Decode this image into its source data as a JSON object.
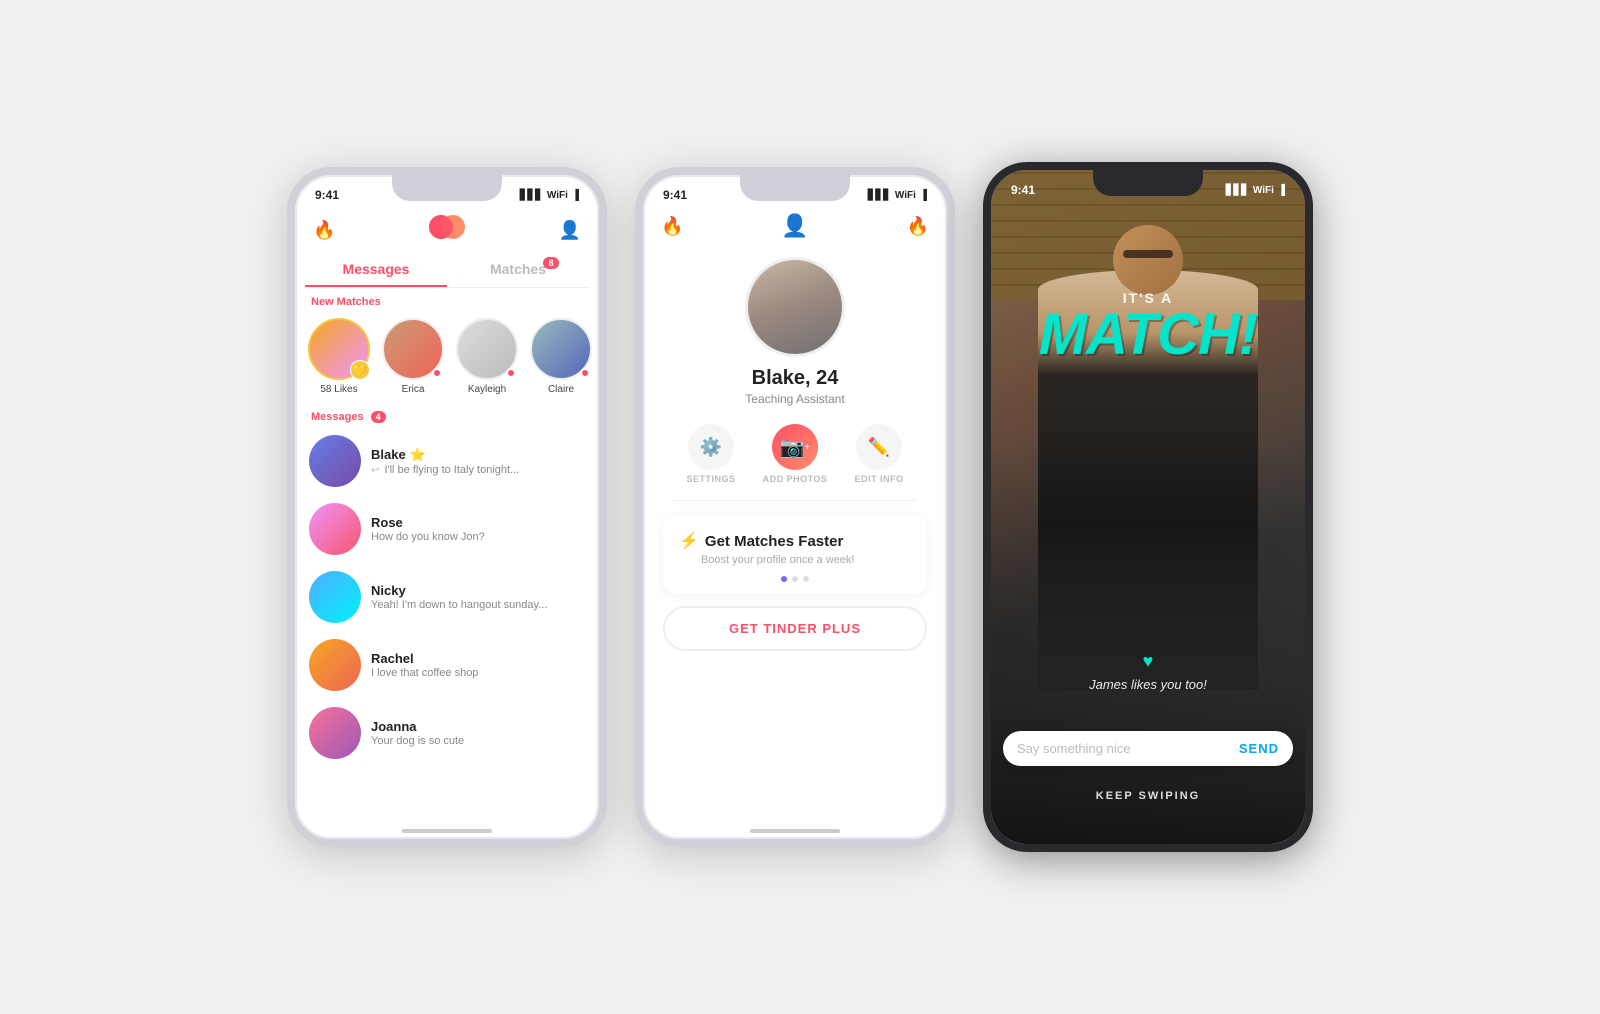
{
  "phones": {
    "phone1": {
      "status": {
        "time": "9:41",
        "signal": "▋▋▋",
        "wifi": "WiFi",
        "battery": "🔋"
      },
      "nav": {
        "left_icon": "flame",
        "right_icon": "profile"
      },
      "tabs": [
        {
          "label": "Messages",
          "active": true,
          "badge": null
        },
        {
          "label": "Matches",
          "active": false,
          "badge": "8"
        }
      ],
      "new_matches_label": "New Matches",
      "matches": [
        {
          "name": "58 Likes",
          "special": true,
          "color": "av-match1"
        },
        {
          "name": "Erica",
          "special": false,
          "color": "av-match2"
        },
        {
          "name": "Kayleigh",
          "special": false,
          "color": "av-match3"
        },
        {
          "name": "Claire",
          "special": false,
          "color": "av-match4"
        }
      ],
      "messages_label": "Messages",
      "messages_badge": "4",
      "conversations": [
        {
          "name": "Blake",
          "star": "⭐",
          "preview": "I'll be flying to Italy tonight...",
          "color": "av-blake",
          "has_reply": true
        },
        {
          "name": "Rose",
          "star": null,
          "preview": "How do you know Jon?",
          "color": "av-rose",
          "has_reply": false
        },
        {
          "name": "Nicky",
          "star": null,
          "preview": "Yeah! I'm down to hangout sunday...",
          "color": "av-nicky",
          "has_reply": false
        },
        {
          "name": "Rachel",
          "star": null,
          "preview": "I love that coffee shop",
          "color": "av-rachel",
          "has_reply": false
        },
        {
          "name": "Joanna",
          "star": null,
          "preview": "Your dog is so cute",
          "color": "av-joanna",
          "has_reply": false
        }
      ]
    },
    "phone2": {
      "status": {
        "time": "9:41"
      },
      "profile": {
        "name": "Blake, 24",
        "job": "Teaching Assistant"
      },
      "actions": [
        {
          "label": "SETTINGS",
          "icon": "⚙"
        },
        {
          "label": "ADD PHOTOS",
          "icon": "📷",
          "main": true
        },
        {
          "label": "EDIT INFO",
          "icon": "✏"
        }
      ],
      "boost_card": {
        "title": "Get Matches Faster",
        "subtitle": "Boost your profile once a week!",
        "lightning": "⚡"
      },
      "dots": [
        true,
        false,
        false
      ],
      "cta_label": "GET TINDER PLUS"
    },
    "phone3": {
      "status": {
        "time": "9:41"
      },
      "overlay": {
        "its_a": "IT'S A",
        "match": "MATCH!",
        "heart": "♥",
        "subtitle": "James likes you too!"
      },
      "input": {
        "placeholder": "Say something nice",
        "send": "SEND"
      },
      "keep_swiping": "KEEP SWIPING"
    }
  }
}
